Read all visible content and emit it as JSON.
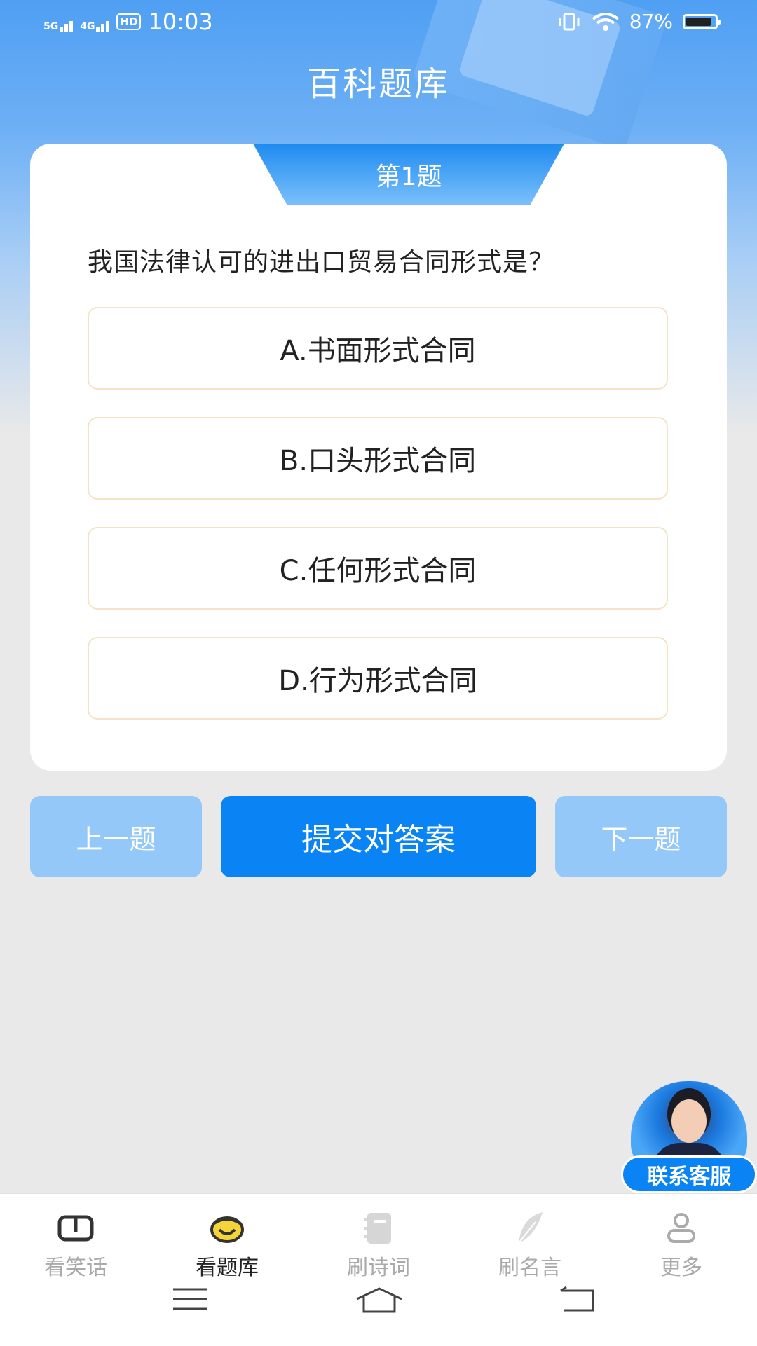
{
  "status_bar": {
    "network_1": "5G",
    "network_2": "4G",
    "hd_label": "HD",
    "time": "10:03",
    "battery": "87%"
  },
  "header": {
    "title": "百科题库"
  },
  "quiz": {
    "question_number": "第1题",
    "question": "我国法律认可的进出口贸易合同形式是？",
    "options": [
      {
        "label": "A.书面形式合同"
      },
      {
        "label": "B.口头形式合同"
      },
      {
        "label": "C.任何形式合同"
      },
      {
        "label": "D.行为形式合同"
      }
    ]
  },
  "actions": {
    "prev_label": "上一题",
    "submit_label": "提交对答案",
    "next_label": "下一题"
  },
  "customer_service": {
    "label": "联系客服"
  },
  "tabbar": {
    "items": [
      {
        "label": "看笑话",
        "icon": "book-icon",
        "active": false
      },
      {
        "label": "看题库",
        "icon": "smiley-icon",
        "active": true
      },
      {
        "label": "刷诗词",
        "icon": "notebook-icon",
        "active": false
      },
      {
        "label": "刷名言",
        "icon": "feather-icon",
        "active": false
      },
      {
        "label": "更多",
        "icon": "person-icon",
        "active": false
      }
    ]
  },
  "colors": {
    "primary": "#0a84f5",
    "secondary_button": "#94c8f9",
    "option_border": "#f5e3c8",
    "active_tab_icon": "#f5d43a"
  }
}
